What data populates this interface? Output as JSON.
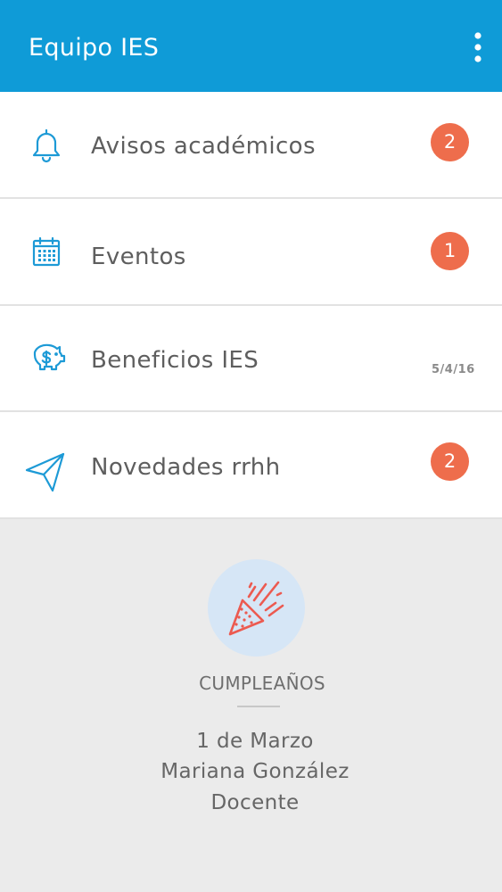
{
  "appbar": {
    "title": "Equipo IES",
    "overflow_icon": "more-vertical-icon",
    "background_color": "#0f9bd7"
  },
  "menu": {
    "items": [
      {
        "label": "Avisos académicos",
        "icon": "bell-icon",
        "badge": "2"
      },
      {
        "label": "Eventos",
        "icon": "calendar-icon",
        "badge": "1"
      },
      {
        "label": "Beneficios IES",
        "icon": "piggy-bank-icon",
        "date": "5/4/16"
      },
      {
        "label": "Novedades rrhh",
        "icon": "paper-plane-icon",
        "badge": "2"
      }
    ],
    "icon_color": "#1d9ad6",
    "badge_color": "#ee6d4c"
  },
  "birthday": {
    "icon": "party-popper-icon",
    "heading": "CUMPLEAÑOS",
    "date": "1 de Marzo",
    "name": "Mariana González",
    "role": "Docente",
    "icon_color": "#ec5a50",
    "circle_color": "#d6e6f6"
  }
}
